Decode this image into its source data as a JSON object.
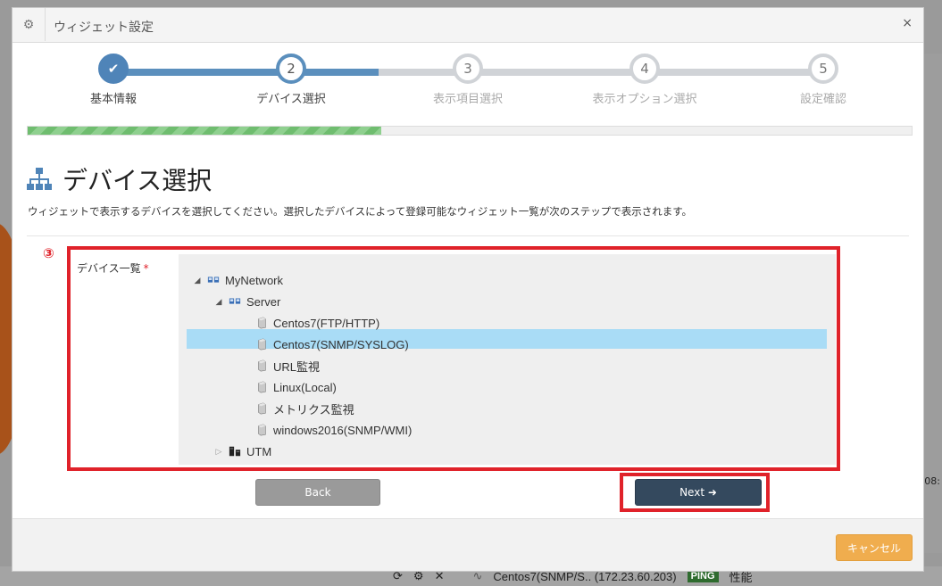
{
  "window": {
    "title": "ウィジェット設定",
    "close_glyph": "×"
  },
  "stepper": {
    "steps": [
      {
        "num": "✔",
        "label": "基本情報",
        "state": "done"
      },
      {
        "num": "2",
        "label": "デバイス選択",
        "state": "active"
      },
      {
        "num": "3",
        "label": "表示項目選択",
        "state": "pending"
      },
      {
        "num": "4",
        "label": "表示オプション選択",
        "state": "pending"
      },
      {
        "num": "5",
        "label": "設定確認",
        "state": "pending"
      }
    ],
    "progress_fraction": 0.4
  },
  "page": {
    "title": "デバイス選択",
    "description": "ウィジェットで表示するデバイスを選択してください。選択したデバイスによって登録可能なウィジェット一覧が次のステップで表示されます。",
    "annotation_marker": "③"
  },
  "device_field": {
    "label": "デバイス一覧",
    "required_mark": "*"
  },
  "tree": {
    "root": "MyNetwork",
    "group": "Server",
    "devices": [
      "Centos7(FTP/HTTP)",
      "Centos7(SNMP/SYSLOG)",
      "URL監視",
      "Linux(Local)",
      "メトリクス監視",
      "windows2016(SNMP/WMI)"
    ],
    "selected": "Centos7(SNMP/SYSLOG)",
    "other": "UTM"
  },
  "buttons": {
    "back": "Back",
    "next": "Next ➜",
    "cancel": "キャンセル"
  },
  "background": {
    "status_device": "Centos7(SNMP/S.. (172.23.60.203)",
    "status_badge": "PING",
    "status_suffix": "性能",
    "time_fragment": "08:"
  },
  "colors": {
    "accent": "#4f84b8",
    "highlight": "#e0222a",
    "selected_row": "#a9dcf6",
    "next_button": "#34495e",
    "cancel_button": "#f0ad4e"
  }
}
